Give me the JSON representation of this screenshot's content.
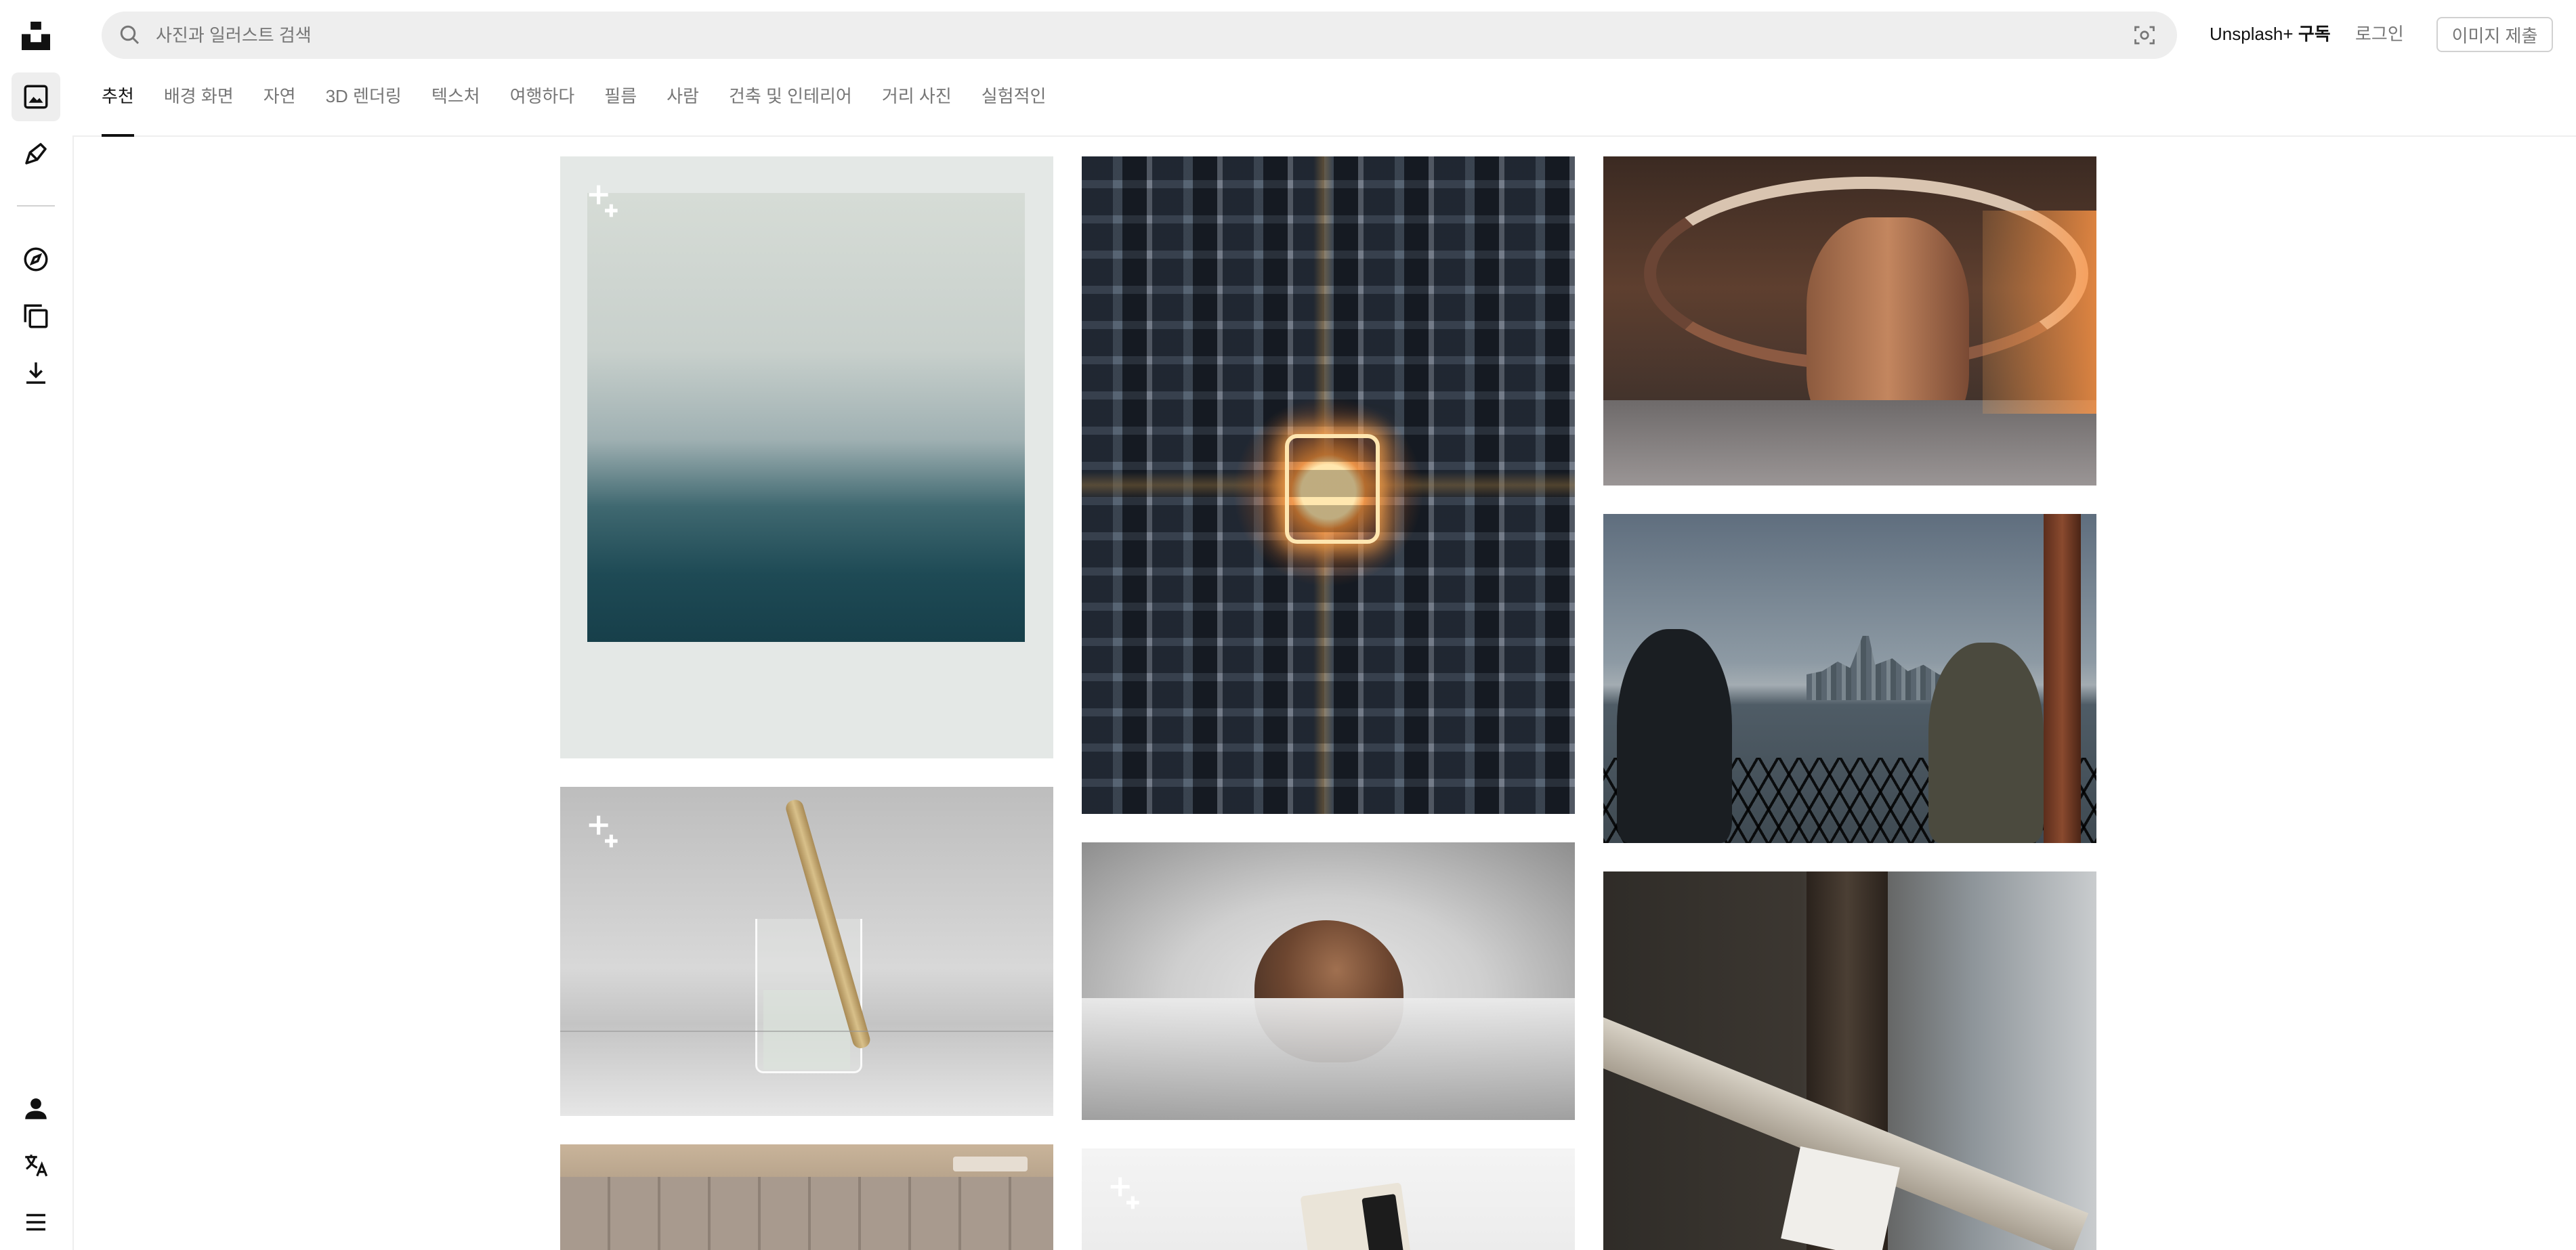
{
  "header": {
    "search_placeholder": "사진과 일러스트 검색",
    "plus_brand": "Unsplash+",
    "plus_action": "구독",
    "login": "로그인",
    "submit": "이미지 제출"
  },
  "tabs": [
    {
      "label": "추천",
      "active": true
    },
    {
      "label": "배경 화면"
    },
    {
      "label": "자연"
    },
    {
      "label": "3D 렌더링"
    },
    {
      "label": "텍스처"
    },
    {
      "label": "여행하다"
    },
    {
      "label": "필름"
    },
    {
      "label": "사람"
    },
    {
      "label": "건축 및 인테리어"
    },
    {
      "label": "거리 사진"
    },
    {
      "label": "실험적인"
    }
  ],
  "rail": {
    "top_icons": [
      "unsplash-logo-icon",
      "photos-icon",
      "illustrations-icon"
    ],
    "mid_icons": [
      "explore-icon",
      "collections-icon",
      "download-icon"
    ],
    "bottom_icons": [
      "user-icon",
      "language-icon",
      "menu-icon"
    ]
  },
  "photos": [
    {
      "name": "photo-rain-polaroid",
      "plus": true,
      "desc": "rain droplets on glass polaroid"
    },
    {
      "name": "photo-beaker-pipette",
      "plus": true,
      "desc": "pipette in beaker of liquid"
    },
    {
      "name": "photo-cabinets",
      "plus": false,
      "desc": "kitchen cabinets"
    },
    {
      "name": "photo-city-aerial",
      "plus": false,
      "desc": "aerial city at night"
    },
    {
      "name": "photo-rock-clouds",
      "plus": false,
      "desc": "rock above clouds"
    },
    {
      "name": "photo-card",
      "plus": true,
      "desc": "card on white"
    },
    {
      "name": "photo-spiral-stairs",
      "plus": false,
      "desc": "spiral wooden staircase"
    },
    {
      "name": "photo-skyline-ferry",
      "plus": false,
      "desc": "skyline from ferry"
    },
    {
      "name": "photo-vintage-sign",
      "plus": false,
      "desc": "vintage sign on wooden post"
    }
  ],
  "colors": {
    "accent_text": "#111111",
    "muted_text": "#767676",
    "search_bg": "#eeeeee",
    "border": "#d1d1d1"
  }
}
